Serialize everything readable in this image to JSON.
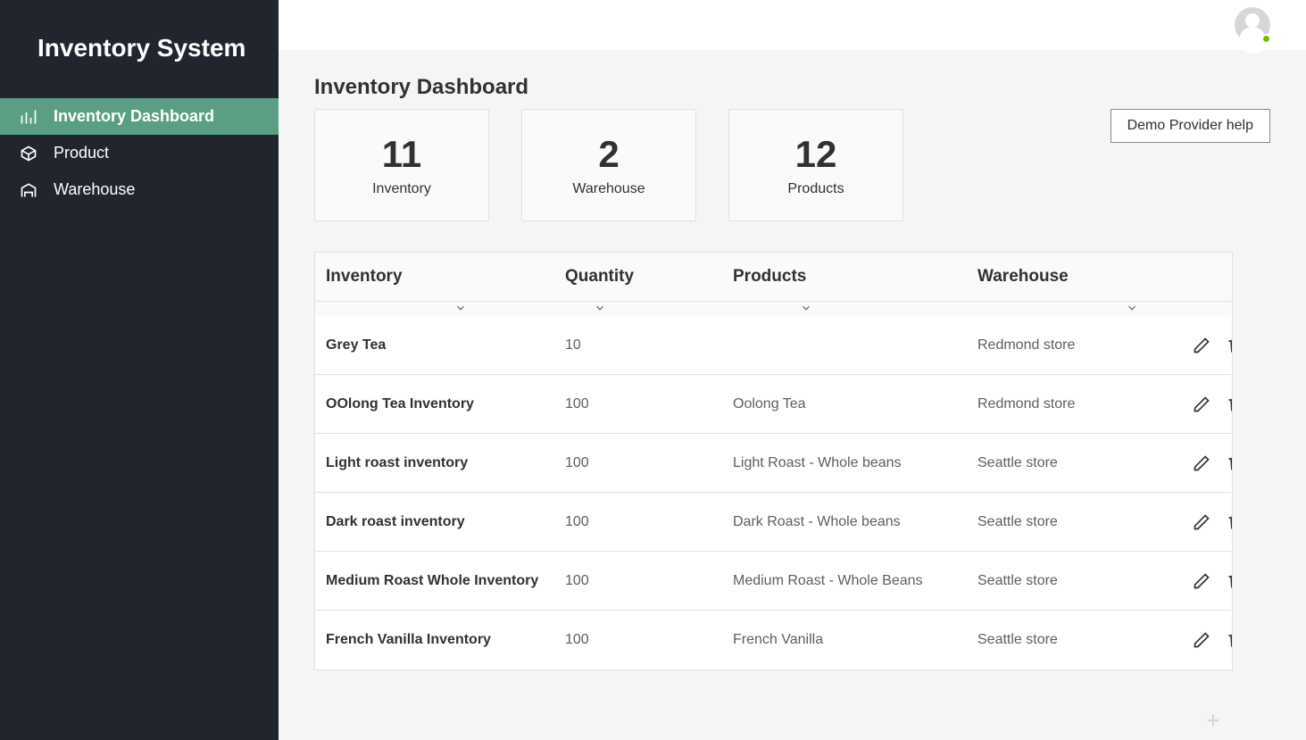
{
  "app_title": "Inventory System",
  "sidebar": {
    "items": [
      {
        "label": "Inventory Dashboard",
        "icon": "dashboard-icon",
        "active": true
      },
      {
        "label": "Product",
        "icon": "product-icon",
        "active": false
      },
      {
        "label": "Warehouse",
        "icon": "warehouse-icon",
        "active": false
      }
    ]
  },
  "header": {
    "help_label": "Demo Provider help"
  },
  "page": {
    "title": "Inventory Dashboard"
  },
  "summary_cards": [
    {
      "value": "11",
      "label": "Inventory"
    },
    {
      "value": "2",
      "label": "Warehouse"
    },
    {
      "value": "12",
      "label": "Products"
    }
  ],
  "table": {
    "columns": [
      "Inventory",
      "Quantity",
      "Products",
      "Warehouse"
    ],
    "rows": [
      {
        "inventory": "Grey Tea",
        "quantity": "10",
        "products": "",
        "warehouse": "Redmond store"
      },
      {
        "inventory": "OOlong Tea Inventory",
        "quantity": "100",
        "products": "Oolong Tea",
        "warehouse": "Redmond store"
      },
      {
        "inventory": "Light roast inventory",
        "quantity": "100",
        "products": "Light Roast - Whole beans",
        "warehouse": "Seattle store"
      },
      {
        "inventory": "Dark roast inventory",
        "quantity": "100",
        "products": "Dark Roast - Whole beans",
        "warehouse": "Seattle store"
      },
      {
        "inventory": "Medium Roast Whole Inventory",
        "quantity": "100",
        "products": "Medium Roast - Whole Beans",
        "warehouse": "Seattle store"
      },
      {
        "inventory": "French Vanilla Inventory",
        "quantity": "100",
        "products": "French Vanilla",
        "warehouse": "Seattle store"
      }
    ]
  },
  "colors": {
    "sidebar_bg": "#21262e",
    "accent": "#5a9e83"
  }
}
